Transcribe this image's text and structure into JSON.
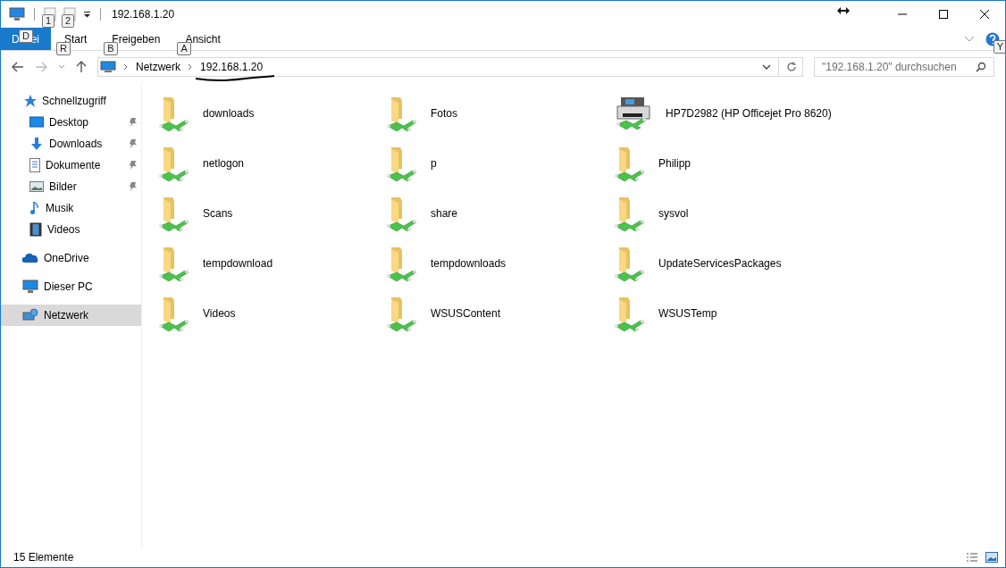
{
  "window": {
    "title": "192.168.1.20"
  },
  "quick_access_keytips": [
    "1",
    "2"
  ],
  "ribbon": {
    "file_tab": {
      "label_start": "D",
      "label_end": "ei",
      "keytip": "D"
    },
    "tabs": [
      {
        "label": "Start",
        "keytip": "R"
      },
      {
        "label": "Freigeben",
        "keytip": "B"
      },
      {
        "label": "Ansicht",
        "keytip": "A"
      }
    ],
    "help_keytip": "Y"
  },
  "address": {
    "crumbs": [
      "Netzwerk",
      "192.168.1.20"
    ]
  },
  "search": {
    "placeholder": "\"192.168.1.20\" durchsuchen"
  },
  "sidebar": {
    "items": [
      {
        "label": "Schnellzugriff",
        "pinned": false,
        "selected": false,
        "children": [
          {
            "label": "Desktop",
            "pinned": true,
            "selected": false
          },
          {
            "label": "Downloads",
            "pinned": true,
            "selected": false
          },
          {
            "label": "Dokumente",
            "pinned": true,
            "selected": false
          },
          {
            "label": "Bilder",
            "pinned": true,
            "selected": false
          },
          {
            "label": "Musik",
            "pinned": false,
            "selected": false
          },
          {
            "label": "Videos",
            "pinned": false,
            "selected": false
          }
        ]
      },
      {
        "label": "OneDrive",
        "pinned": false,
        "selected": false
      },
      {
        "label": "Dieser PC",
        "pinned": false,
        "selected": false
      },
      {
        "label": "Netzwerk",
        "pinned": false,
        "selected": true
      }
    ]
  },
  "items": [
    {
      "name": "downloads",
      "kind": "folder"
    },
    {
      "name": "Fotos",
      "kind": "folder"
    },
    {
      "name": "HP7D2982 (HP Officejet Pro 8620)",
      "kind": "printer"
    },
    {
      "name": "netlogon",
      "kind": "folder"
    },
    {
      "name": "p",
      "kind": "folder"
    },
    {
      "name": "Philipp",
      "kind": "folder"
    },
    {
      "name": "Scans",
      "kind": "folder"
    },
    {
      "name": "share",
      "kind": "folder"
    },
    {
      "name": "sysvol",
      "kind": "folder"
    },
    {
      "name": "tempdownload",
      "kind": "folder"
    },
    {
      "name": "tempdownloads",
      "kind": "folder"
    },
    {
      "name": "UpdateServicesPackages",
      "kind": "folder"
    },
    {
      "name": "Videos",
      "kind": "folder"
    },
    {
      "name": "WSUSContent",
      "kind": "folder"
    },
    {
      "name": "WSUSTemp",
      "kind": "folder"
    }
  ],
  "status_bar": {
    "count": "15 Elemente"
  }
}
